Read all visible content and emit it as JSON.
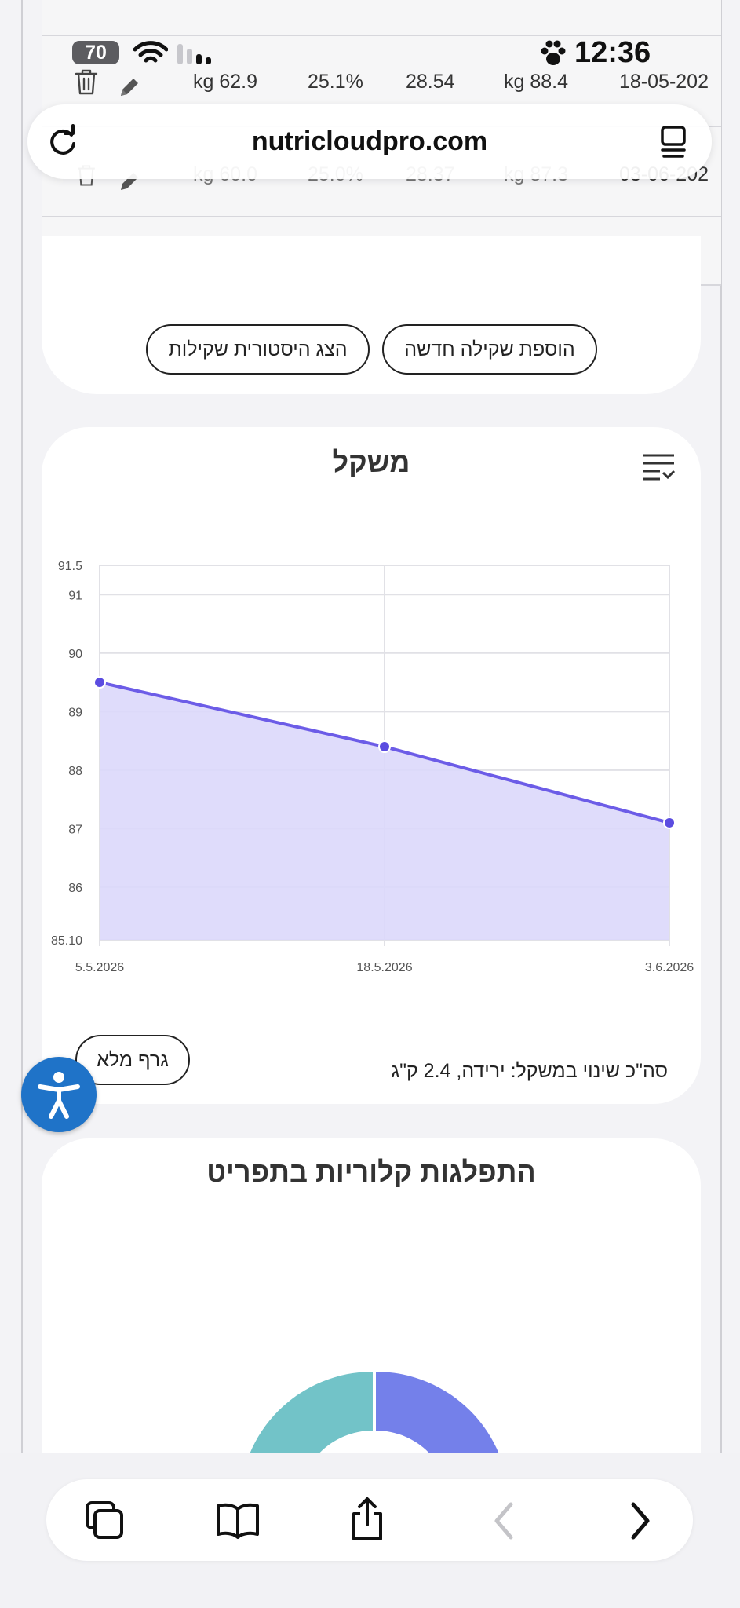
{
  "browser": {
    "url": "nutricloudpro.com",
    "status": {
      "time": "12:36",
      "battery": "70"
    }
  },
  "table": {
    "row1": {
      "weight": "kg 62.9",
      "fat_percent": "25.1%",
      "bmi": "28.54",
      "ideal": "kg 88.4",
      "date": "18-05-202"
    },
    "row2_partial": {
      "weight": "kg 60.0",
      "fat_percent": "25.0%",
      "bmi": "28.37",
      "ideal": "kg 87.3",
      "date": "03-06-202"
    },
    "empty_row": [
      "----",
      "----",
      "----",
      "----",
      "----"
    ]
  },
  "buttons": {
    "add_weighing": "הוספת שקילה חדשה",
    "show_history": "הצג היסטורית שקילות"
  },
  "weight_card": {
    "title": "משקל",
    "full_graph_button": "גרף מלא",
    "total_change": "סה\"כ שינוי במשקל: ירידה, 2.4 ק\"ג"
  },
  "calories_card": {
    "title": "התפלגות קלוריות בתפריט"
  },
  "colors": {
    "line": "#6c5ce7",
    "area": "#dcd8fb",
    "point": "#5b4ce0",
    "accessibility": "#1f73c8",
    "donut_teal": "#72c3c8",
    "donut_blue": "#7480ea"
  },
  "icons": {
    "trash": "trash-icon",
    "edit": "pencil-icon",
    "reload": "reload-icon",
    "reader": "reader-icon",
    "menu": "menu-list-icon",
    "tabs": "tabs-icon",
    "bookmarks": "book-icon",
    "share": "share-icon",
    "back": "chevron-left-icon",
    "forward": "chevron-right-icon",
    "accessibility": "accessibility-icon"
  },
  "chart_data": {
    "type": "area",
    "title": "משקל",
    "categories": [
      "5.5.2026",
      "18.5.2026",
      "3.6.2026"
    ],
    "values": [
      89.5,
      88.4,
      87.1
    ],
    "ylim": [
      85.1,
      91.5
    ],
    "yticks": [
      "91.5",
      "91",
      "90",
      "89",
      "88",
      "87",
      "86",
      "85.10"
    ],
    "grid": true
  }
}
